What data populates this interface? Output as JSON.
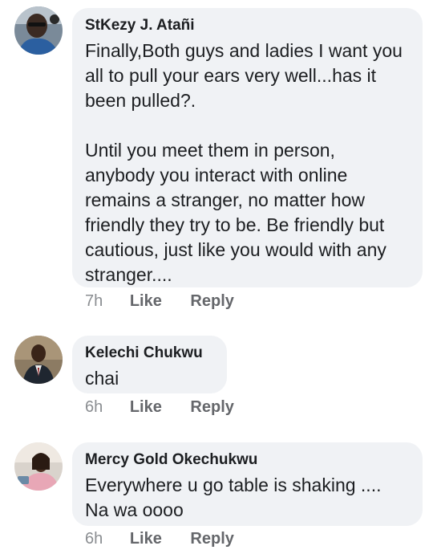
{
  "comments": [
    {
      "author": "StKezy J. Atañi",
      "paragraphs": [
        "Finally,Both guys and ladies I want you all to pull your ears very well...has it been pulled?.",
        "Until you meet them in person, anybody you interact with online remains a stranger, no matter how friendly they try to be. Be friendly but cautious, just like you would with any stranger...."
      ],
      "time": "7h",
      "like_label": "Like",
      "reply_label": "Reply"
    },
    {
      "author": "Kelechi Chukwu",
      "paragraphs": [
        "chai"
      ],
      "time": "6h",
      "like_label": "Like",
      "reply_label": "Reply"
    },
    {
      "author": "Mercy Gold Okechukwu",
      "paragraphs": [
        "Everywhere u go table is shaking .... Na wa oooo"
      ],
      "time": "6h",
      "like_label": "Like",
      "reply_label": "Reply"
    }
  ],
  "colors": {
    "bubble": "#f0f2f5",
    "name_text": "#1c1e21",
    "action_text": "#65676b"
  }
}
